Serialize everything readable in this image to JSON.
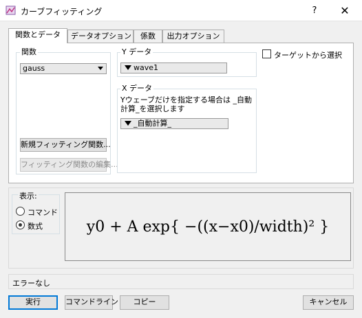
{
  "window": {
    "title": "カーブフィッティング",
    "help": "?",
    "close": "✕"
  },
  "tabs": [
    "関数とデータ",
    "データオプション",
    "係数",
    "出力オプション"
  ],
  "function_group": {
    "label": "関数",
    "selected": "gauss",
    "new_button": "新規フィッティング関数...",
    "edit_button": "フィッティング関数の編集..."
  },
  "y_data": {
    "label": "Y データ",
    "selected": "wave1"
  },
  "x_data": {
    "label": "X データ",
    "hint": "Yウェーブだけを指定する場合は _自動計算_を選択します",
    "selected": "_自動計算_"
  },
  "target_checkbox": {
    "label": "ターゲットから選択",
    "checked": false
  },
  "display": {
    "label": "表示:",
    "options": [
      "コマンド",
      "数式"
    ],
    "selected": "数式"
  },
  "formula_text": "y0 + A exp{ −((x−x0)/width)² }",
  "status": "エラーなし",
  "buttons": {
    "execute": "実行",
    "command_line": "コマンドライン",
    "copy": "コピー",
    "cancel": "キャンセル"
  }
}
